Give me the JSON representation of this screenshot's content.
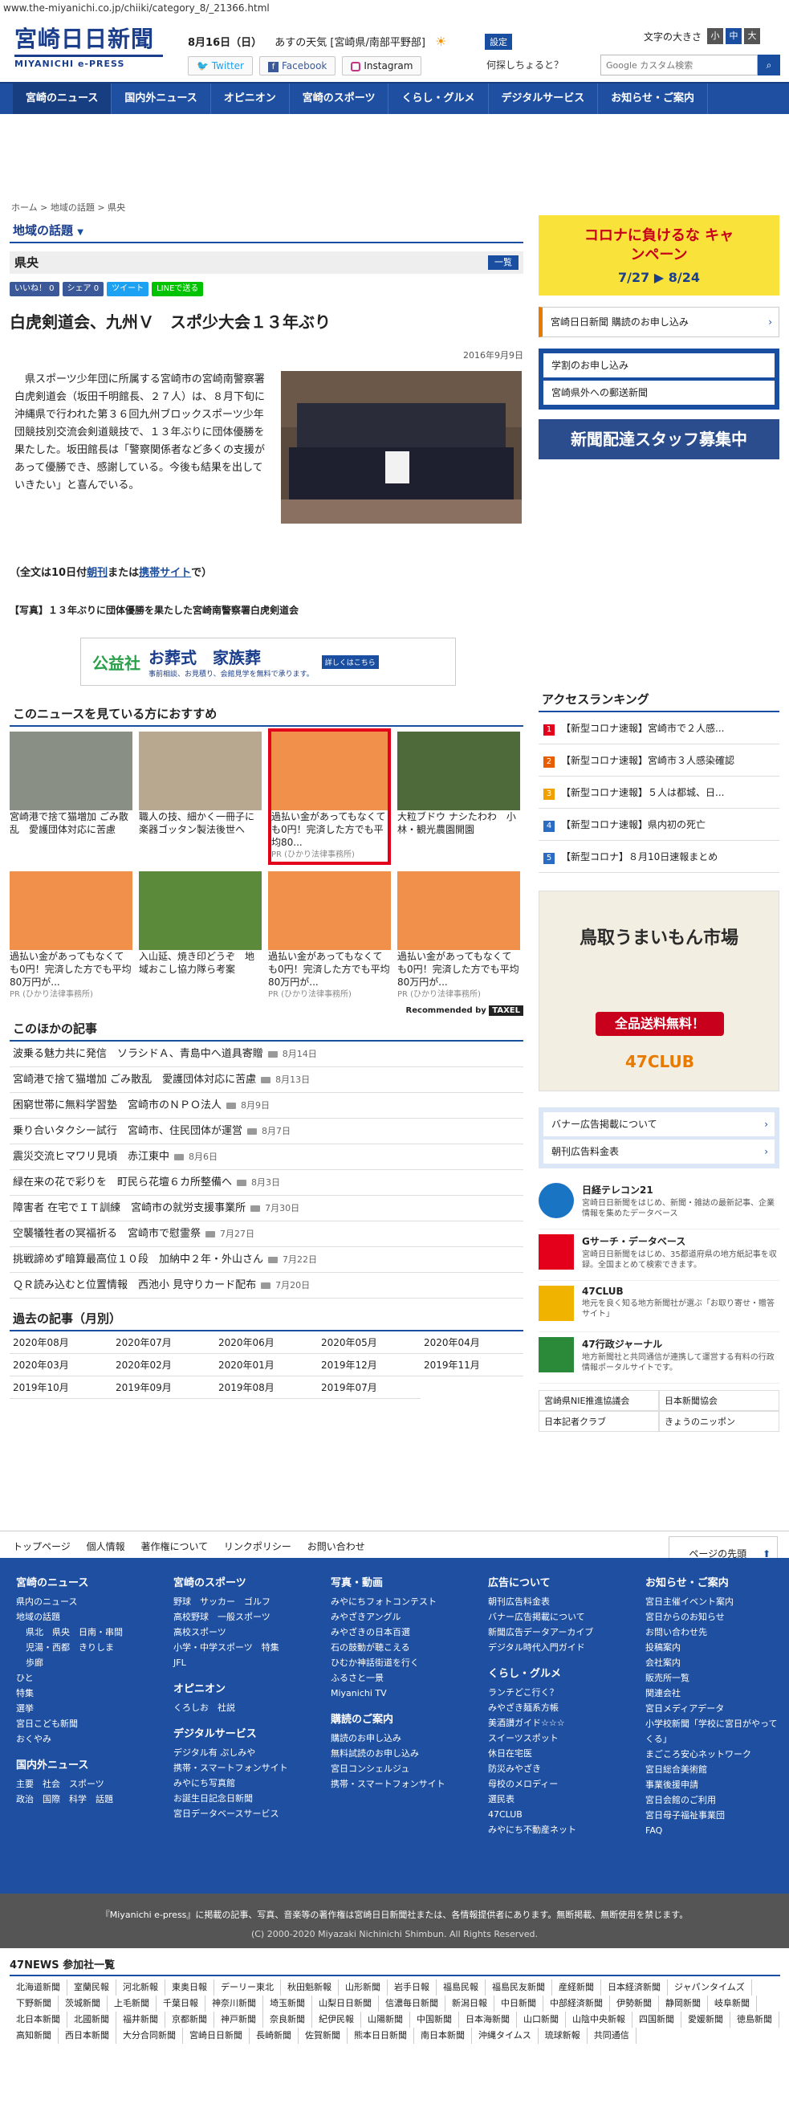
{
  "url": "www.the-miyanichi.co.jp/chiiki/category_8/_21366.html",
  "header": {
    "logo_main": "宮崎日日新聞",
    "logo_sub": "MIYANICHI e-PRESS",
    "date": "8月16日（日）",
    "weather": "あすの天気 [宮崎県/南部平野部]",
    "settings_label": "設定",
    "twitter_label": "Twitter",
    "facebook_label": "Facebook",
    "instagram_label": "Instagram",
    "ask_text": "何探しちょると？",
    "font_size_label": "文字の大きさ",
    "font_small": "小",
    "font_medium": "中",
    "font_large": "大",
    "search_placeholder": "Google カスタム検索"
  },
  "nav": [
    "宮崎のニュース",
    "国内外ニュース",
    "オピニオン",
    "宮崎のスポーツ",
    "くらし・グルメ",
    "デジタルサービス",
    "お知らせ・ご案内"
  ],
  "breadcrumb": [
    "ホーム",
    "地域の話題",
    "県央"
  ],
  "section_title": "地域の話題",
  "sub_title": "県央",
  "list_button": "一覧",
  "share": {
    "fb_like": "いいね！ 0",
    "fb_share": "シェア 0",
    "tweet": "ツイート",
    "line": "LINEで送る"
  },
  "article": {
    "title": "白虎剣道会、九州Ｖ　スポ少大会１３年ぶり",
    "date": "2016年9月9日",
    "body": "県スポーツ少年団に所属する宮崎市の宮崎南警察署白虎剣道会（坂田千明館長、２７人）は、８月下旬に沖縄県で行われた第３６回九州ブロックスポーツ少年団競技別交流会剣道競技で、１３年ぶりに団体優勝を果たした。坂田館長は「警察関係者など多くの支援があって優勝でき、感謝している。今後も結果を出していきたい」と喜んでいる。",
    "full_note_pre": "（全文は10日付",
    "full_note_link1": "朝刊",
    "full_note_mid": "または",
    "full_note_link2": "携帯サイト",
    "full_note_post": "で）",
    "caption": "【写真】１３年ぶりに団体優勝を果たした宮崎南警察署白虎剣道会"
  },
  "ad_banner": {
    "org": "公益社",
    "text": "お葬式　家族葬",
    "sub": "事前相談、お見積り、会館見学を無料で承ります。",
    "more": "詳しくはこちら"
  },
  "recommend": {
    "title": "このニュースを見ている方におすすめ",
    "items": [
      {
        "text": "宮崎港で捨て猫増加 ごみ散乱　愛護団体対応に苦慮",
        "pr": ""
      },
      {
        "text": "職人の技、細かく一冊子に　楽器ゴッタン製法後世へ",
        "pr": ""
      },
      {
        "text": "過払い金があってもなくても0円！完済した方でも平均80...",
        "pr": "PR (ひかり法律事務所)"
      },
      {
        "text": "大粒ブドウ ナシたわわ　小林・観光農園開園",
        "pr": ""
      },
      {
        "text": "過払い金があってもなくても0円！完済した方でも平均80万円が...",
        "pr": "PR (ひかり法律事務所)"
      },
      {
        "text": "入山延、焼き印どうぞ　地域おこし協力隊ら考案",
        "pr": ""
      },
      {
        "text": "過払い金があってもなくても0円！完済した方でも平均80万円が...",
        "pr": "PR (ひかり法律事務所)"
      },
      {
        "text": "過払い金があってもなくても0円！完済した方でも平均80万円が...",
        "pr": "PR (ひかり法律事務所)"
      }
    ],
    "recommended_by": "Recommended by",
    "tixel": "TAXEL"
  },
  "other": {
    "title": "このほかの記事",
    "items": [
      {
        "title": "波乗る魅力共に発信　ソラシドＡ、青島中へ道具寄贈",
        "date": "8月14日"
      },
      {
        "title": "宮崎港で捨て猫増加 ごみ散乱　愛護団体対応に苦慮",
        "date": "8月13日"
      },
      {
        "title": "困窮世帯に無料学習塾　宮崎市のＮＰＯ法人",
        "date": "8月9日"
      },
      {
        "title": "乗り合いタクシー試行　宮崎市、住民団体が運営",
        "date": "8月7日"
      },
      {
        "title": "震災交流ヒマワリ見頃　赤江東中",
        "date": "8月6日"
      },
      {
        "title": "緑在来の花で彩りを　町民ら花壇６カ所整備へ",
        "date": "8月3日"
      },
      {
        "title": "障害者 在宅でＩＴ訓練　宮崎市の就労支援事業所",
        "date": "7月30日"
      },
      {
        "title": "空襲犠牲者の冥福祈る　宮崎市で慰霊祭",
        "date": "7月27日"
      },
      {
        "title": "挑戦諦めず暗算最高位１０段　加納中２年・外山さん",
        "date": "7月22日"
      },
      {
        "title": "ＱＲ読み込むと位置情報　西池小 見守りカード配布",
        "date": "7月20日"
      }
    ]
  },
  "past": {
    "title": "過去の記事（月別）",
    "months": [
      "2020年08月",
      "2020年07月",
      "2020年06月",
      "2020年05月",
      "2020年04月",
      "2020年03月",
      "2020年02月",
      "2020年01月",
      "2019年12月",
      "2019年11月",
      "2019年10月",
      "2019年09月",
      "2019年08月",
      "2019年07月"
    ]
  },
  "side": {
    "campaign_title": "コロナに負けるな キャンペーン",
    "campaign_dates": "7/27 ▶ 8/24",
    "subscribe": "宮崎日日新聞 購読のお申し込み",
    "links": [
      "学割のお申し込み",
      "宮崎県外への郵送新聞"
    ],
    "recruit": "新聞配達スタッフ募集中",
    "ranking_title": "アクセスランキング",
    "ranking": [
      "【新型コロナ速報】宮崎市で２人感...",
      "【新型コロナ速報】宮崎市３人感染確認",
      "【新型コロナ速報】５人は都城、日...",
      "【新型コロナ速報】県内初の死亡",
      "【新型コロナ】８月10日速報まとめ"
    ],
    "ranking_colors": [
      "#e4001b",
      "#e85d00",
      "#f0a000",
      "#2a6cc4",
      "#2a6cc4"
    ],
    "food_title": "鳥取うまいもん市場",
    "food_sale": "全品送料無料！",
    "food_club": "47CLUB",
    "ad_links": [
      "バナー広告掲載について",
      "朝刊広告料金表"
    ],
    "services": [
      {
        "title": "日経テレコン21",
        "desc": "宮崎日日新聞をはじめ、新聞・雑誌の最新記事、企業情報を集めたデータベース"
      },
      {
        "title": "Gサーチ・データベース",
        "desc": "宮崎日日新聞をはじめ、35都道府県の地方紙記事を収録。全国まとめて検索できます。"
      },
      {
        "title": "47CLUB",
        "desc": "地元を良く知る地方新聞社が選ぶ「お取り寄せ・贈答サイト」"
      },
      {
        "title": "47行政ジャーナル",
        "desc": "地方新聞社と共同通信が連携して運営する有料の行政情報ポータルサイトです。"
      }
    ],
    "bottom_links": [
      "宮崎県NIE推進協議会",
      "日本新聞協会",
      "日本記者クラブ",
      "きょうのニッポン"
    ]
  },
  "footnav": [
    "トップページ",
    "個人情報",
    "著作権について",
    "リンクポリシー",
    "お問い合わせ"
  ],
  "pagetop": "ページの先頭",
  "footer": {
    "col1": {
      "title": "宮崎のニュース",
      "items": [
        "県内のニュース",
        "地域の話題",
        "県北　県央　日南・串間",
        "児湯・西都　きりしま",
        "歩廊",
        "ひと",
        "特集",
        "選挙",
        "宮日こども新聞",
        "おくやみ"
      ],
      "title2": "国内外ニュース",
      "items2": [
        "主要　社会　スポーツ",
        "政治　国際　科学　話題"
      ]
    },
    "col2": {
      "title": "宮崎のスポーツ",
      "items": [
        "野球　サッカー　ゴルフ",
        "高校野球　一般スポーツ",
        "高校スポーツ",
        "小学・中学スポーツ　特集",
        "JFL"
      ],
      "title2": "オピニオン",
      "items2": [
        "くろしお　社説"
      ],
      "title3": "デジタルサービス",
      "items3": [
        "デジタル有 ぷしみや",
        "携帯・スマートフォンサイト",
        "みやにち写真館",
        "お誕生日記念日新聞",
        "宮日データベースサービス"
      ]
    },
    "col3": {
      "title": "写真・動画",
      "items": [
        "みやにちフォトコンテスト",
        "みやざきアングル",
        "みやざきの日本百選",
        "石の鼓動が聴こえる",
        "ひむか神話街道を行く",
        "ふるさと一景",
        "Miyanichi TV"
      ],
      "title2": "購読のご案内",
      "items2": [
        "購読のお申し込み",
        "無料試読のお申し込み",
        "宮日コンシェルジュ",
        "携帯・スマートフォンサイト"
      ]
    },
    "col4": {
      "title": "広告について",
      "items": [
        "朝刊広告料金表",
        "バナー広告掲載について",
        "新聞広告データアーカイブ",
        "デジタル時代入門ガイド"
      ],
      "title2": "くらし・グルメ",
      "items2": [
        "ランチどこ行く？",
        "みやざき麺系方帳",
        "美酒讃ガイド☆☆☆",
        "スイーツスポット",
        "休日在宅医",
        "防災みやざき",
        "母校のメロディー",
        "選民表",
        "47CLUB",
        "みやにち不動産ネット"
      ]
    },
    "col5": {
      "title": "お知らせ・ご案内",
      "items": [
        "宮日主催イベント案内",
        "宮日からのお知らせ",
        "お問い合わせ先",
        "投稿案内",
        "会社案内",
        "販売所一覧",
        "関連会社",
        "宮日メディアデータ",
        "小学校新聞「学校に宮日がやってくる」",
        "まごころ安心ネットワーク",
        "宮日総合美術館",
        "事業後援申請",
        "宮日会館のご利用",
        "宮日母子福祉事業団",
        "FAQ"
      ]
    }
  },
  "copyright": {
    "notice": "『Miyanichi e-press』に掲載の記事、写真、音楽等の著作権は宮崎日日新聞社または、各情報提供者にあります。無断掲載、無断使用を禁じます。",
    "line": "(C) 2000-2020 Miyazaki Nichinichi Shimbun. All Rights Reserved."
  },
  "news47": {
    "title": "47NEWS 参加社一覧",
    "papers": [
      "北海道新聞",
      "室蘭民報",
      "河北新報",
      "東奥日報",
      "デーリー東北",
      "秋田魁新報",
      "山形新聞",
      "岩手日報",
      "福島民報",
      "福島民友新聞",
      "産経新聞",
      "日本経済新聞",
      "ジャパンタイムズ",
      "下野新聞",
      "茨城新聞",
      "上毛新聞",
      "千葉日報",
      "神奈川新聞",
      "埼玉新聞",
      "山梨日日新聞",
      "信濃毎日新聞",
      "新潟日報",
      "中日新聞",
      "中部経済新聞",
      "伊勢新聞",
      "静岡新聞",
      "岐阜新聞",
      "北日本新聞",
      "北國新聞",
      "福井新聞",
      "京都新聞",
      "神戸新聞",
      "奈良新聞",
      "紀伊民報",
      "山陽新聞",
      "中国新聞",
      "日本海新聞",
      "山口新聞",
      "山陰中央新報",
      "四国新聞",
      "愛媛新聞",
      "徳島新聞",
      "高知新聞",
      "西日本新聞",
      "大分合同新聞",
      "宮崎日日新聞",
      "長崎新聞",
      "佐賀新聞",
      "熊本日日新聞",
      "南日本新聞",
      "沖縄タイムス",
      "琉球新報",
      "共同通信"
    ]
  }
}
